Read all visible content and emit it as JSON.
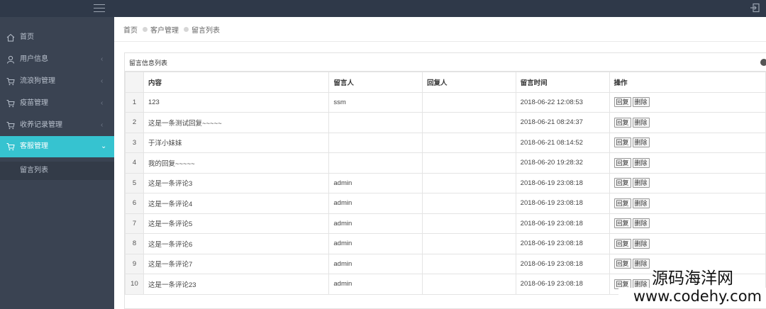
{
  "sidebar": {
    "items": [
      {
        "label": "首页",
        "icon": "home-icon",
        "arrow": ""
      },
      {
        "label": "用户信息",
        "icon": "user-icon",
        "arrow": "‹"
      },
      {
        "label": "流浪狗管理",
        "icon": "cart-icon",
        "arrow": "‹"
      },
      {
        "label": "疫苗管理",
        "icon": "cart-icon",
        "arrow": "‹"
      },
      {
        "label": "收养记录管理",
        "icon": "cart-icon",
        "arrow": "‹"
      },
      {
        "label": "客服管理",
        "icon": "cart-icon",
        "arrow": "⌄"
      }
    ],
    "sub_item": "留言列表"
  },
  "breadcrumb": [
    "首页",
    "客户管理",
    "留言列表"
  ],
  "panel": {
    "title": "留言信息列表"
  },
  "table": {
    "headers": [
      "内容",
      "留言人",
      "回复人",
      "留言时间",
      "操作"
    ],
    "rows": [
      {
        "idx": "1",
        "content": "123",
        "author": "ssm",
        "replier": "",
        "time": "2018-06-22 12:08:53"
      },
      {
        "idx": "2",
        "content": "这是一条测试回复~~~~~",
        "author": "",
        "replier": "",
        "time": "2018-06-21 08:24:37"
      },
      {
        "idx": "3",
        "content": "于洋小妹妹",
        "author": "",
        "replier": "",
        "time": "2018-06-21 08:14:52"
      },
      {
        "idx": "4",
        "content": "我的回复~~~~~",
        "author": "",
        "replier": "",
        "time": "2018-06-20 19:28:32"
      },
      {
        "idx": "5",
        "content": "这是一条评论3",
        "author": "admin",
        "replier": "",
        "time": "2018-06-19 23:08:18"
      },
      {
        "idx": "6",
        "content": "这是一条评论4",
        "author": "admin",
        "replier": "",
        "time": "2018-06-19 23:08:18"
      },
      {
        "idx": "7",
        "content": "这是一条评论5",
        "author": "admin",
        "replier": "",
        "time": "2018-06-19 23:08:18"
      },
      {
        "idx": "8",
        "content": "这是一条评论6",
        "author": "admin",
        "replier": "",
        "time": "2018-06-19 23:08:18"
      },
      {
        "idx": "9",
        "content": "这是一条评论7",
        "author": "admin",
        "replier": "",
        "time": "2018-06-19 23:08:18"
      },
      {
        "idx": "10",
        "content": "这是一条评论23",
        "author": "admin",
        "replier": "",
        "time": "2018-06-19 23:08:18"
      }
    ],
    "actions": {
      "reply": "回复",
      "delete": "删除"
    }
  },
  "watermark": {
    "line1": "源码海洋网",
    "line2": "www.codehy.com"
  },
  "colors": {
    "topbar": "#2f3949",
    "sidebar": "#3a4352",
    "active": "#36c3d0"
  }
}
